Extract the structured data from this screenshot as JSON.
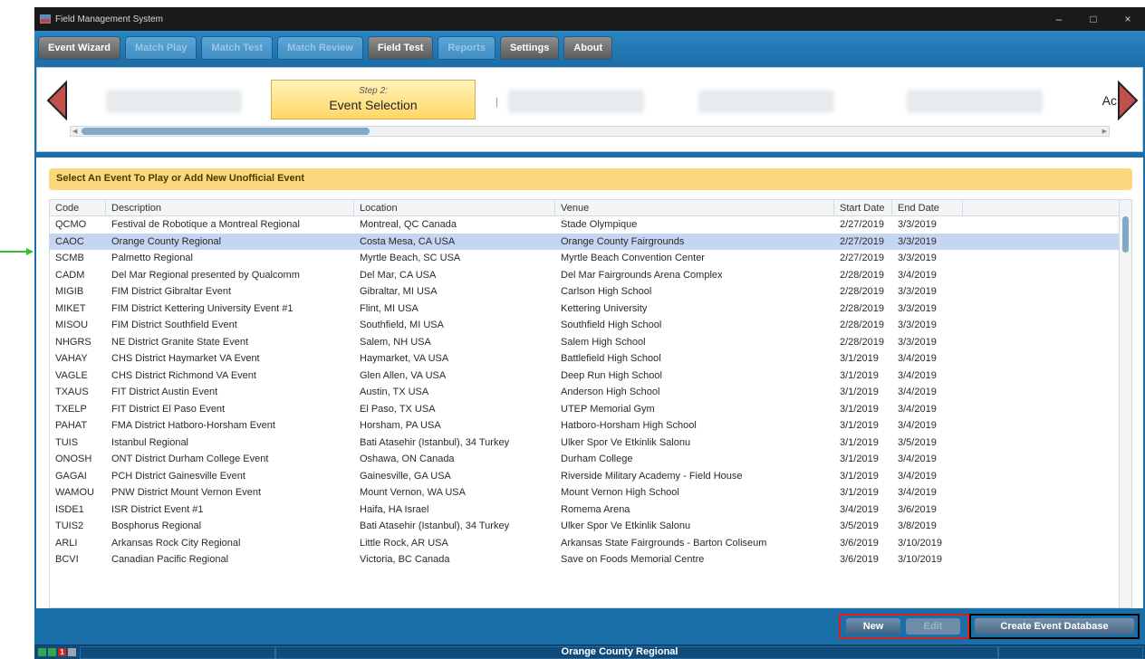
{
  "window": {
    "title": "Field Management System",
    "controls": {
      "minimize": "–",
      "maximize": "□",
      "close": "×"
    }
  },
  "menu": [
    {
      "label": "Event Wizard",
      "state": "active"
    },
    {
      "label": "Match Play",
      "state": "disabled"
    },
    {
      "label": "Match Test",
      "state": "disabled"
    },
    {
      "label": "Match Review",
      "state": "disabled"
    },
    {
      "label": "Field Test",
      "state": "active"
    },
    {
      "label": "Reports",
      "state": "disabled"
    },
    {
      "label": "Settings",
      "state": "active"
    },
    {
      "label": "About",
      "state": "active"
    }
  ],
  "wizard": {
    "active_step_number": "Step 2:",
    "active_step_title": "Event Selection",
    "pipe": "|",
    "truncated_next": "Ac"
  },
  "banner": "Select An Event To Play or Add New Unofficial Event",
  "table": {
    "headers": [
      "Code",
      "Description",
      "Location",
      "Venue",
      "Start Date",
      "End Date"
    ],
    "selected_index": 1,
    "rows": [
      [
        "QCMO",
        "Festival de Robotique a Montreal Regional",
        "Montreal, QC Canada",
        "Stade Olympique",
        "2/27/2019",
        "3/3/2019"
      ],
      [
        "CAOC",
        "Orange County Regional",
        "Costa Mesa, CA USA",
        "Orange County Fairgrounds",
        "2/27/2019",
        "3/3/2019"
      ],
      [
        "SCMB",
        "Palmetto Regional",
        "Myrtle Beach, SC USA",
        "Myrtle Beach Convention Center",
        "2/27/2019",
        "3/3/2019"
      ],
      [
        "CADM",
        "Del Mar Regional presented by Qualcomm",
        "Del Mar, CA USA",
        "Del Mar Fairgrounds Arena Complex",
        "2/28/2019",
        "3/4/2019"
      ],
      [
        "MIGIB",
        "FIM District Gibraltar Event",
        "Gibraltar, MI USA",
        "Carlson High School",
        "2/28/2019",
        "3/3/2019"
      ],
      [
        "MIKET",
        "FIM District Kettering University Event #1",
        "Flint, MI USA",
        "Kettering University",
        "2/28/2019",
        "3/3/2019"
      ],
      [
        "MISOU",
        "FIM District Southfield Event",
        "Southfield, MI USA",
        "Southfield High School",
        "2/28/2019",
        "3/3/2019"
      ],
      [
        "NHGRS",
        "NE District Granite State Event",
        "Salem, NH USA",
        "Salem High School",
        "2/28/2019",
        "3/3/2019"
      ],
      [
        "VAHAY",
        "CHS District Haymarket VA Event",
        "Haymarket, VA USA",
        "Battlefield High School",
        "3/1/2019",
        "3/4/2019"
      ],
      [
        "VAGLE",
        "CHS District Richmond VA Event",
        "Glen Allen, VA USA",
        "Deep Run High School",
        "3/1/2019",
        "3/4/2019"
      ],
      [
        "TXAUS",
        "FIT District Austin Event",
        "Austin, TX USA",
        "Anderson High School",
        "3/1/2019",
        "3/4/2019"
      ],
      [
        "TXELP",
        "FIT District El Paso Event",
        "El Paso, TX USA",
        "UTEP Memorial Gym",
        "3/1/2019",
        "3/4/2019"
      ],
      [
        "PAHAT",
        "FMA District Hatboro-Horsham Event",
        "Horsham, PA USA",
        "Hatboro-Horsham High School",
        "3/1/2019",
        "3/4/2019"
      ],
      [
        "TUIS",
        "Istanbul Regional",
        "Bati Atasehir (Istanbul), 34 Turkey",
        "Ulker Spor Ve Etkinlik Salonu",
        "3/1/2019",
        "3/5/2019"
      ],
      [
        "ONOSH",
        "ONT District Durham College Event",
        "Oshawa, ON Canada",
        "Durham College",
        "3/1/2019",
        "3/4/2019"
      ],
      [
        "GAGAI",
        "PCH District Gainesville Event",
        "Gainesville, GA USA",
        "Riverside Military Academy - Field House",
        "3/1/2019",
        "3/4/2019"
      ],
      [
        "WAMOU",
        "PNW District Mount Vernon Event",
        "Mount Vernon, WA USA",
        "Mount Vernon High School",
        "3/1/2019",
        "3/4/2019"
      ],
      [
        "ISDE1",
        "ISR District Event #1",
        "Haifa, HA Israel",
        "Romema Arena",
        "3/4/2019",
        "3/6/2019"
      ],
      [
        "TUIS2",
        "Bosphorus Regional",
        "Bati Atasehir (Istanbul), 34 Turkey",
        "Ulker Spor Ve Etkinlik Salonu",
        "3/5/2019",
        "3/8/2019"
      ],
      [
        "ARLI",
        "Arkansas Rock City Regional",
        "Little Rock, AR USA",
        "Arkansas State Fairgrounds - Barton Coliseum",
        "3/6/2019",
        "3/10/2019"
      ],
      [
        "BCVI",
        "Canadian Pacific Regional",
        "Victoria, BC Canada",
        "Save on Foods Memorial Centre",
        "3/6/2019",
        "3/10/2019"
      ]
    ]
  },
  "actions": {
    "new": "New",
    "edit": "Edit",
    "create": "Create Event Database"
  },
  "status": {
    "event_name": "Orange County Regional",
    "indicator": "1"
  },
  "colors": {
    "app_blue": "#1b6fa8",
    "banner_yellow": "#fbd87d",
    "selected_row": "#c5d6f2",
    "highlight_red": "#e01e1e",
    "pointer_green": "#2fbf2f"
  }
}
